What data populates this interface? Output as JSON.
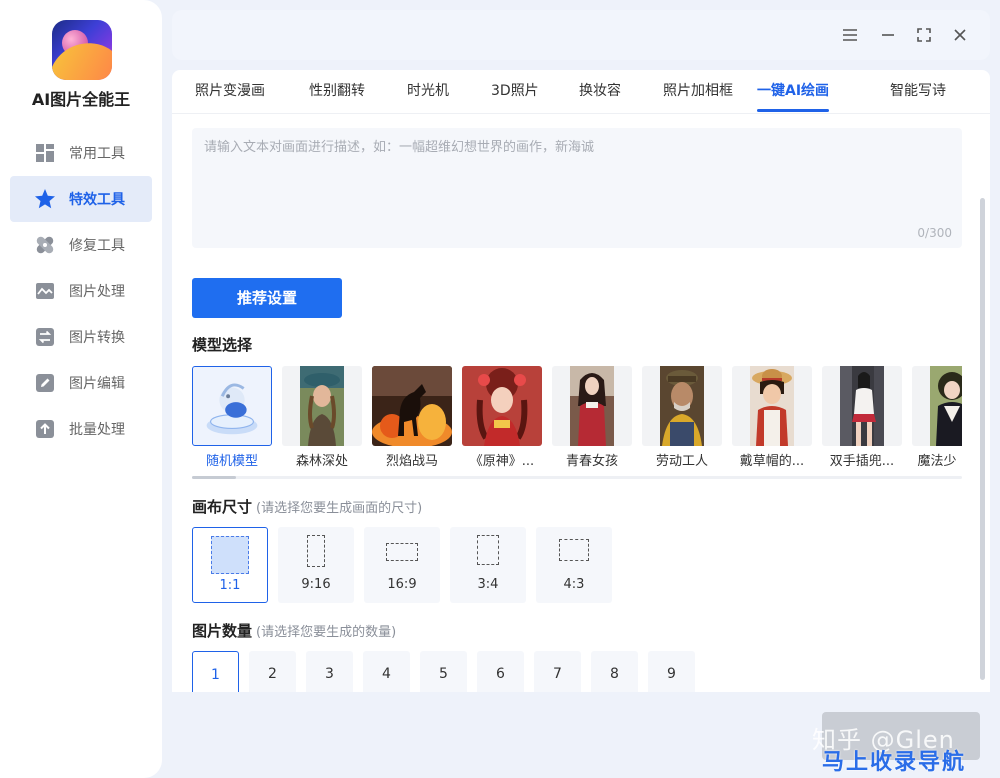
{
  "app": {
    "name": "AI图片全能王"
  },
  "sidebar": {
    "items": [
      {
        "label": "常用工具",
        "icon": "grid-icon",
        "active": false
      },
      {
        "label": "特效工具",
        "icon": "star-icon",
        "active": true
      },
      {
        "label": "修复工具",
        "icon": "bandage-icon",
        "active": false
      },
      {
        "label": "图片处理",
        "icon": "image-wave-icon",
        "active": false
      },
      {
        "label": "图片转换",
        "icon": "convert-icon",
        "active": false
      },
      {
        "label": "图片编辑",
        "icon": "edit-icon",
        "active": false
      },
      {
        "label": "批量处理",
        "icon": "upload-icon",
        "active": false
      }
    ]
  },
  "window": {
    "controls": [
      "menu-icon",
      "minimize-icon",
      "maximize-icon",
      "close-icon"
    ]
  },
  "tabs": [
    {
      "label": "照片变漫画",
      "active": false
    },
    {
      "label": "性别翻转",
      "active": false
    },
    {
      "label": "时光机",
      "active": false
    },
    {
      "label": "3D照片",
      "active": false
    },
    {
      "label": "换妆容",
      "active": false
    },
    {
      "label": "照片加相框",
      "active": false
    },
    {
      "label": "一键AI绘画",
      "active": true
    },
    {
      "label": "智能写诗",
      "active": false
    }
  ],
  "prompt": {
    "placeholder": "请输入文本对画面进行描述，如：一幅超维幻想世界的画作，新海诚",
    "value": "",
    "counter": "0/300"
  },
  "recommend_button": "推荐设置",
  "model_section": {
    "title": "模型选择",
    "models": [
      {
        "label": "随机模型",
        "active": true
      },
      {
        "label": "森林深处",
        "active": false
      },
      {
        "label": "烈焰战马",
        "active": false
      },
      {
        "label": "《原神》...",
        "active": false
      },
      {
        "label": "青春女孩",
        "active": false
      },
      {
        "label": "劳动工人",
        "active": false
      },
      {
        "label": "戴草帽的...",
        "active": false
      },
      {
        "label": "双手插兜...",
        "active": false
      },
      {
        "label": "魔法少",
        "active": false
      }
    ]
  },
  "canvas_section": {
    "title": "画布尺寸",
    "hint": "(请选择您要生成画面的尺寸)",
    "options": [
      {
        "label": "1:1",
        "active": true
      },
      {
        "label": "9:16",
        "active": false
      },
      {
        "label": "16:9",
        "active": false
      },
      {
        "label": "3:4",
        "active": false
      },
      {
        "label": "4:3",
        "active": false
      }
    ]
  },
  "count_section": {
    "title": "图片数量",
    "hint": "(请选择您要生成的数量)",
    "options": [
      "1",
      "2",
      "3",
      "4",
      "5",
      "6",
      "7",
      "8",
      "9"
    ],
    "selected": "1"
  },
  "watermark": {
    "line1": "知乎 @Glen",
    "line2": "马上收录导航"
  },
  "colors": {
    "accent": "#1f62e8",
    "button": "#1f6ef0",
    "background": "#eef2fa"
  }
}
